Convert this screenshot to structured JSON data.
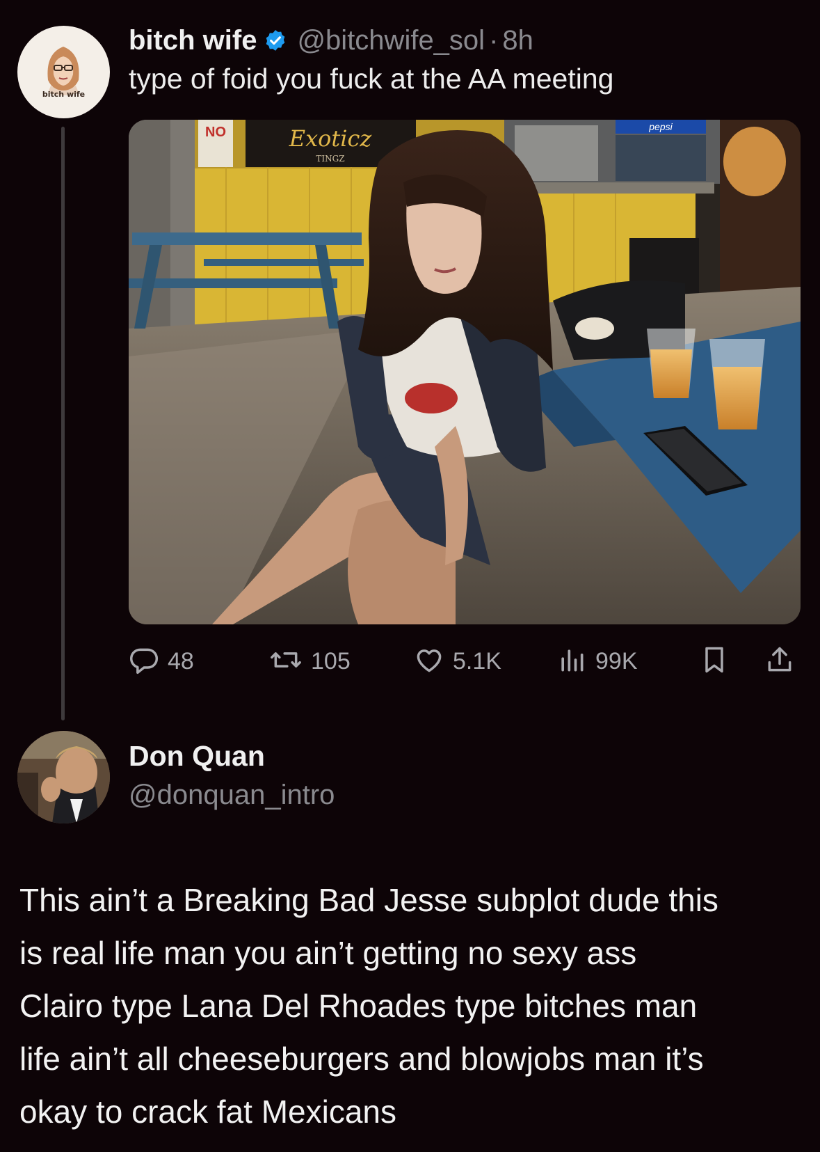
{
  "tweet": {
    "display_name": "bitch wife",
    "handle": "@bitchwife_sol",
    "separator": "·",
    "time": "8h",
    "text": "type of foid you fuck at the AA meeting",
    "avatar_caption": "bitch wife",
    "image_signs": {
      "no_sign": "NO",
      "shop_sign": "Exoticz",
      "shop_sign_sub": "TINGZ",
      "pepsi": "pepsi"
    },
    "stats": {
      "replies": "48",
      "reposts": "105",
      "likes": "5.1K",
      "views": "99K"
    }
  },
  "reply": {
    "display_name": "Don Quan",
    "handle": "@donquan_intro",
    "lines": [
      "This ain’t a Breaking Bad Jesse subplot dude this",
      "is real life man you ain’t getting no sexy ass",
      "Clairo type Lana Del Rhoades type bitches man",
      "life ain’t all cheeseburgers and blowjobs man it’s",
      "okay to crack fat Mexicans"
    ]
  },
  "colors": {
    "background": "#0d0407",
    "verified_blue": "#1d9bf0",
    "muted_text": "#8a8a8f",
    "icon_gray": "#a9a9ae"
  }
}
